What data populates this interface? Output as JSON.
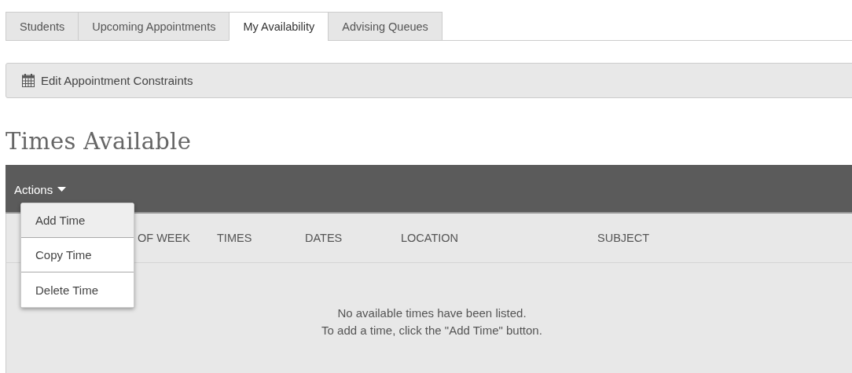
{
  "tabs": [
    {
      "label": "Students",
      "selected": false
    },
    {
      "label": "Upcoming Appointments",
      "selected": false
    },
    {
      "label": "My Availability",
      "selected": true
    },
    {
      "label": "Advising Queues",
      "selected": false
    }
  ],
  "toolbar": {
    "button": "Edit Appointment Constraints"
  },
  "heading": "Times Available",
  "actions_menu": {
    "label": "Actions",
    "items": [
      {
        "label": "Add Time",
        "selected": true
      },
      {
        "label": "Copy Time",
        "selected": false
      },
      {
        "label": "Delete Time",
        "selected": false
      }
    ]
  },
  "table": {
    "columns": [
      "OF WEEK",
      "TIMES",
      "DATES",
      "LOCATION",
      "SUBJECT"
    ],
    "empty_message": [
      "No available times have been listed.",
      "To add a time, click the \"Add Time\" button."
    ]
  }
}
